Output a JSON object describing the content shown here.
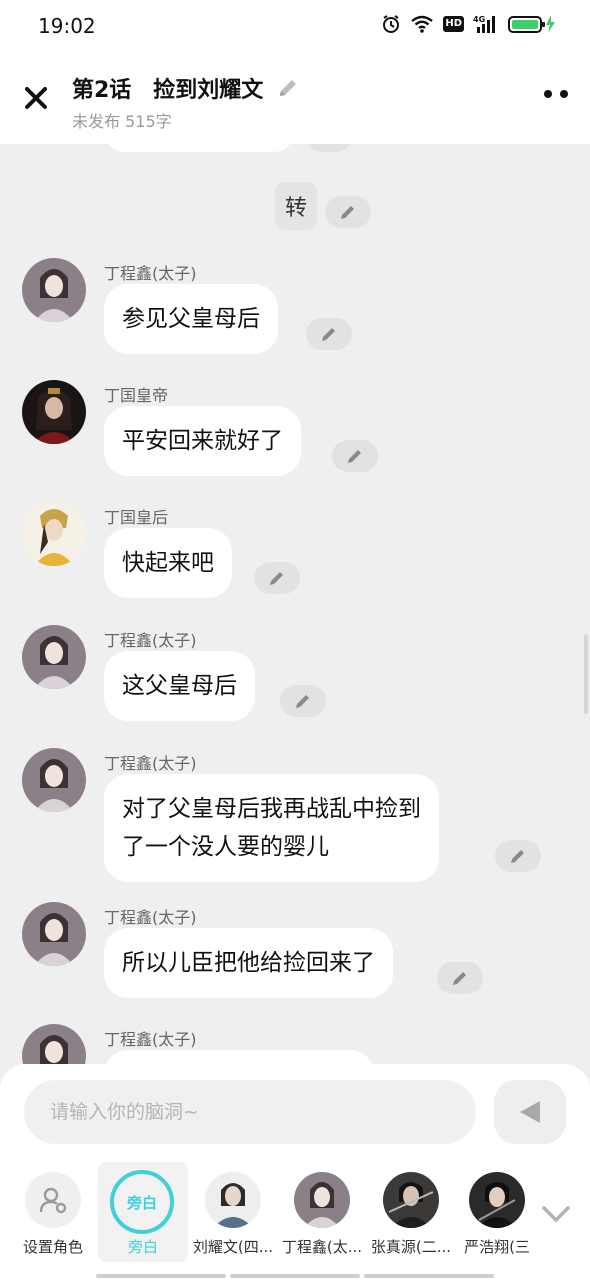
{
  "status_bar": {
    "time": "19:02",
    "network": "4G",
    "hd_badge": "HD",
    "battery_color": "#3ccf6b"
  },
  "header": {
    "title": "第2话　捡到刘耀文",
    "subtitle": "未发布 515字"
  },
  "chat": {
    "center_chip": "转",
    "messages": [
      {
        "speaker": "丁程鑫(太子)",
        "lines": [
          "参见父皇母后"
        ],
        "avatar": "dingchengxin"
      },
      {
        "speaker": "丁国皇帝",
        "lines": [
          "平安回来就好了"
        ],
        "avatar": "emperor"
      },
      {
        "speaker": "丁国皇后",
        "lines": [
          "快起来吧"
        ],
        "avatar": "empress"
      },
      {
        "speaker": "丁程鑫(太子)",
        "lines": [
          "这父皇母后"
        ],
        "avatar": "dingchengxin"
      },
      {
        "speaker": "丁程鑫(太子)",
        "lines": [
          "对了父皇母后我再战乱中捡到",
          "了一个没人要的婴儿"
        ],
        "avatar": "dingchengxin"
      },
      {
        "speaker": "丁程鑫(太子)",
        "lines": [
          "所以儿臣把他给捡回来了"
        ],
        "avatar": "dingchengxin"
      },
      {
        "speaker": "丁程鑫(太子)",
        "lines": [
          ""
        ],
        "avatar": "dingchengxin"
      }
    ]
  },
  "composer": {
    "placeholder": "请输入你的脑洞~"
  },
  "roles": [
    {
      "label": "设置角色",
      "type": "settings"
    },
    {
      "label": "旁白",
      "type": "narrator",
      "ring_text": "旁白",
      "active": true
    },
    {
      "label": "刘耀文(四...",
      "type": "person"
    },
    {
      "label": "丁程鑫(太...",
      "type": "person"
    },
    {
      "label": "张真源(二...",
      "type": "person"
    },
    {
      "label": "严浩翔(三",
      "type": "person"
    }
  ],
  "colors": {
    "accent": "#3fd0d8",
    "bubble": "#ffffff",
    "background": "#efefef"
  }
}
